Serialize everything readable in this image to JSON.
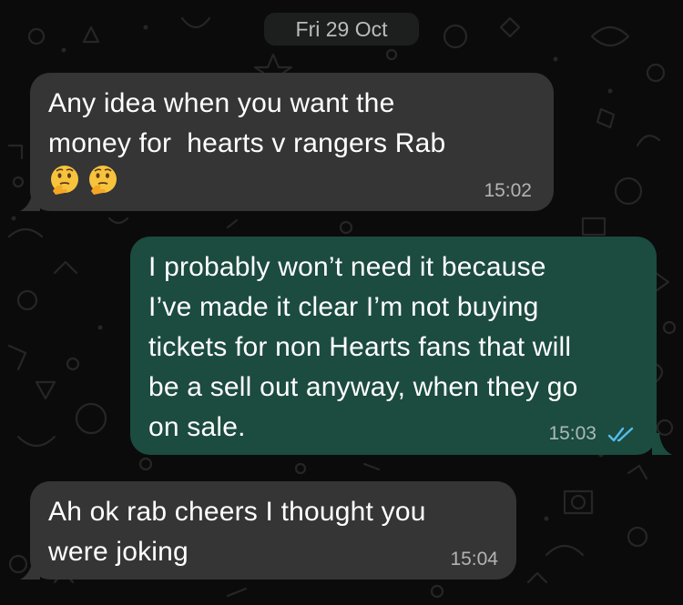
{
  "chat": {
    "date_separator": "Fri 29 Oct",
    "messages": [
      {
        "direction": "incoming",
        "text": "Any idea when you want the\nmoney for  hearts v rangers Rab",
        "emojis": [
          "thinking-face",
          "thinking-face"
        ],
        "time": "15:02"
      },
      {
        "direction": "outgoing",
        "text": "I probably won’t need it because\nI’ve made it clear I’m not buying\ntickets for non Hearts fans that will\nbe a sell out anyway, when they go\non sale.",
        "time": "15:03",
        "status_icon": "double-check-read-icon"
      },
      {
        "direction": "incoming",
        "text": "Ah ok rab cheers I thought you\nwere joking",
        "time": "15:04"
      }
    ]
  },
  "colors": {
    "background": "#0b0b0b",
    "incoming_bubble": "#353535",
    "outgoing_bubble": "#1c4b40",
    "read_ticks": "#53bdeb",
    "date_pill": "#1d1f1f"
  }
}
